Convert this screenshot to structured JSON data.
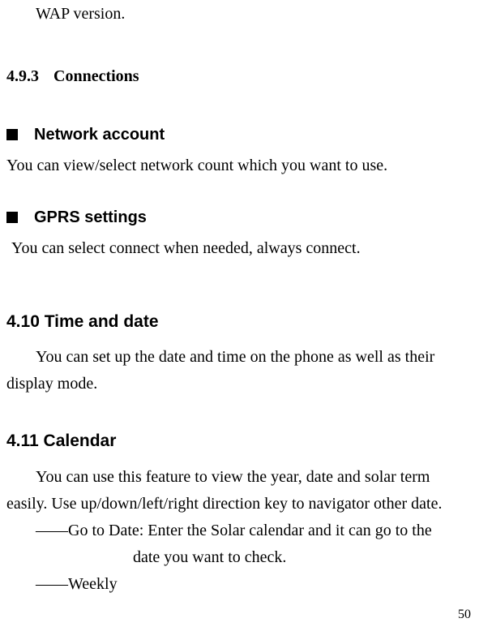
{
  "top_fragment": "WAP version.",
  "s493": {
    "num": "4.9.3",
    "title": "Connections"
  },
  "network": {
    "heading": "Network account",
    "body": "You can view/select network count which you want to use."
  },
  "gprs": {
    "heading": "GPRS settings",
    "body": "You can select connect when needed, always connect."
  },
  "s410": {
    "heading": "4.10  Time and date",
    "body_line1": "You can set up the date and time on the phone as well as their",
    "body_line2": "display mode."
  },
  "s411": {
    "heading": "4.11  Calendar",
    "body_line1": "You can use this feature to view the year, date and solar term",
    "body_line2": "easily. Use up/down/left/right direction key to navigator other date.",
    "dash1_a": "――Go to Date: Enter the Solar calendar and it can go to the",
    "dash1_b": "date you want to check.",
    "dash2": "――Weekly"
  },
  "page_number": "50"
}
